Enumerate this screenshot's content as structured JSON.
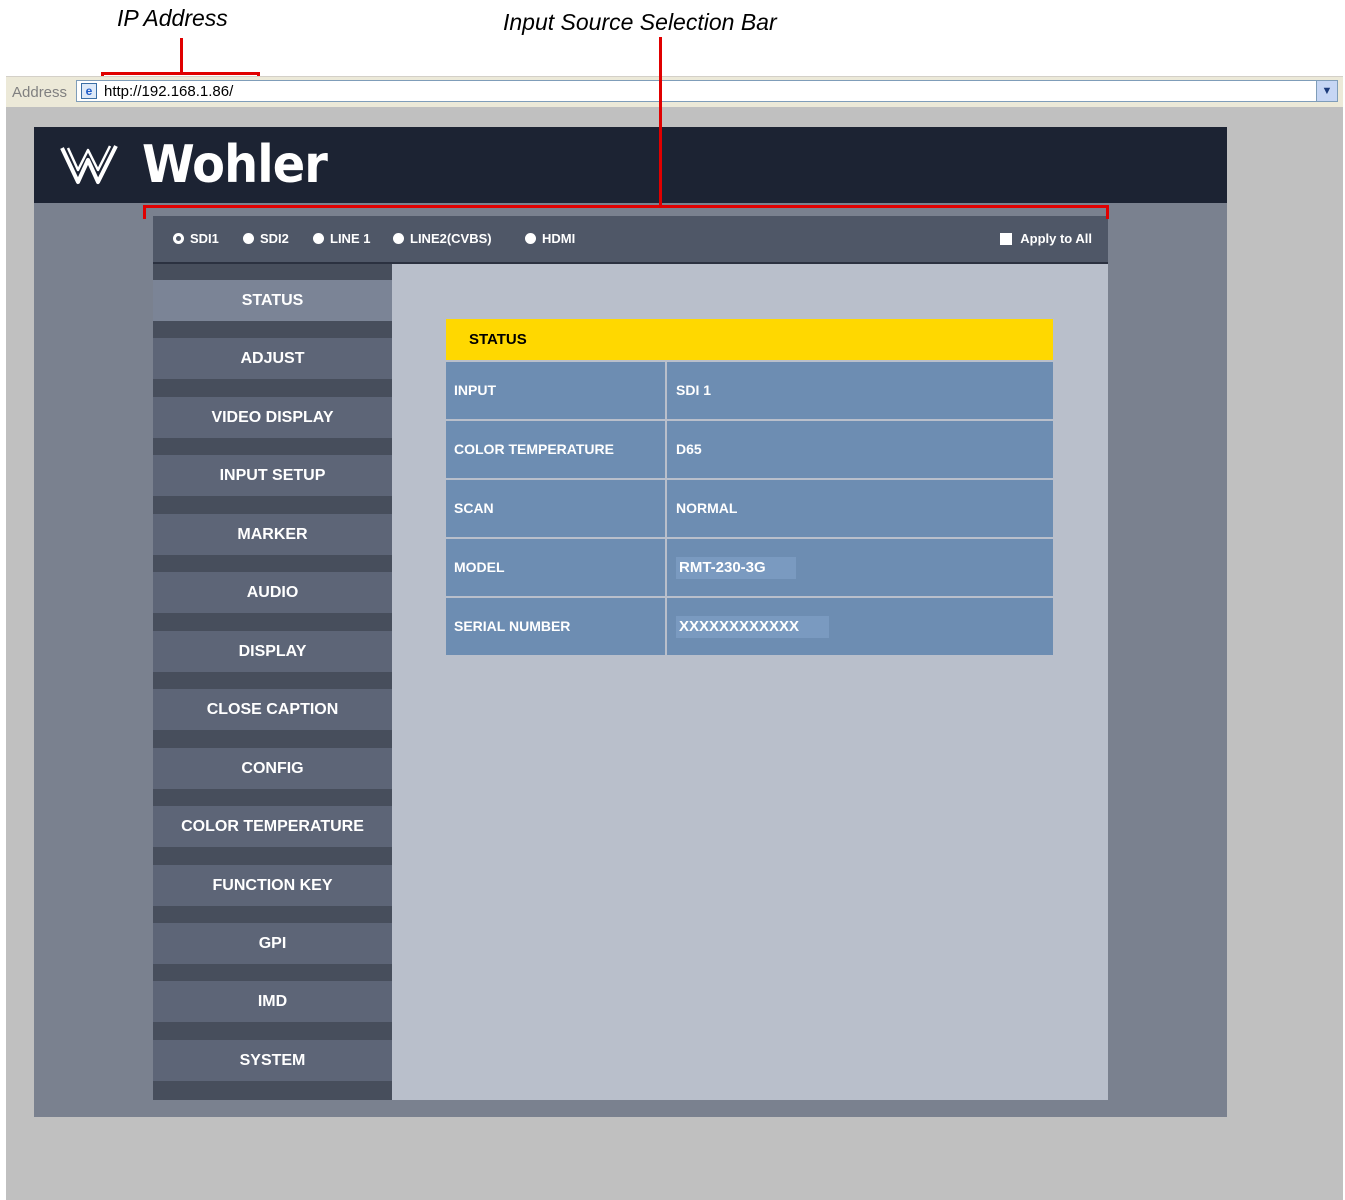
{
  "annotations": {
    "ip_address": "IP Address",
    "input_source_bar": "Input Source Selection Bar"
  },
  "browser": {
    "address_label": "Address",
    "url": "http://192.168.1.86/",
    "dropdown_icon": "chevron-down-icon"
  },
  "brand": {
    "logo_text": "Wohler"
  },
  "source_bar": {
    "inputs": [
      {
        "label": "SDI1",
        "selected": true
      },
      {
        "label": "SDI2",
        "selected": false
      },
      {
        "label": "LINE 1",
        "selected": false
      },
      {
        "label": "LINE2(CVBS)",
        "selected": false
      },
      {
        "label": "HDMI",
        "selected": false
      }
    ],
    "apply_all_label": "Apply to All",
    "apply_all_checked": false
  },
  "sidebar": {
    "items": [
      "STATUS",
      "ADJUST",
      "VIDEO DISPLAY",
      "INPUT SETUP",
      "MARKER",
      "AUDIO",
      "DISPLAY",
      "CLOSE CAPTION",
      "CONFIG",
      "COLOR TEMPERATURE",
      "FUNCTION KEY",
      "GPI",
      "IMD",
      "SYSTEM"
    ],
    "active": "STATUS"
  },
  "status": {
    "title": "STATUS",
    "rows": [
      {
        "label": "INPUT",
        "value": "SDI 1"
      },
      {
        "label": "COLOR TEMPERATURE",
        "value": "D65"
      },
      {
        "label": "SCAN",
        "value": "NORMAL"
      },
      {
        "label": "MODEL",
        "value": "RMT-230-3G"
      },
      {
        "label": "SERIAL NUMBER",
        "value": "XXXXXXXXXXXX"
      }
    ]
  },
  "colors": {
    "header_bg": "#1c2333",
    "status_header": "#ffd800",
    "table_cell": "#6d8db2",
    "annotation_red": "#e00000"
  }
}
